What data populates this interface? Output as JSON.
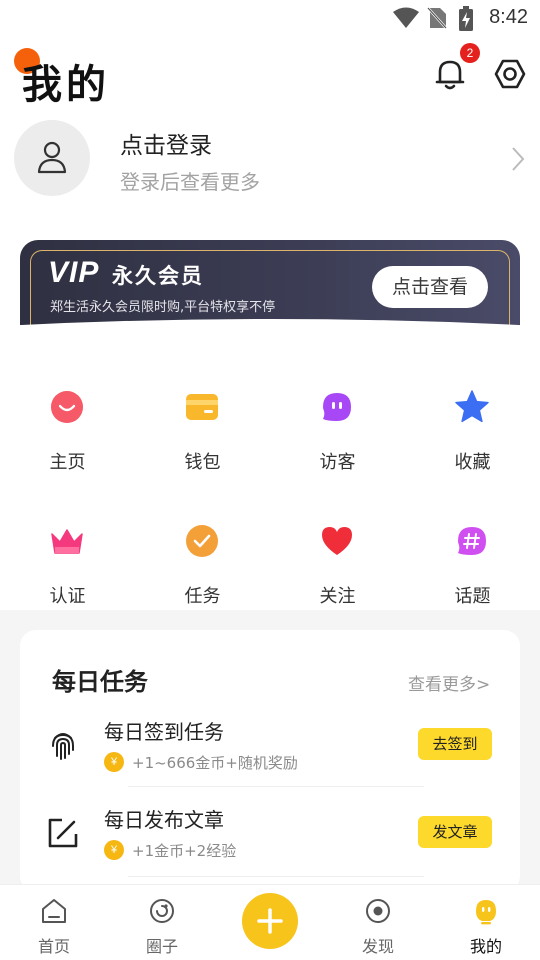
{
  "status_bar": {
    "time": "8:42"
  },
  "header": {
    "title": "我的",
    "notification_count": "2"
  },
  "profile": {
    "login_title": "点击登录",
    "login_subtitle": "登录后查看更多"
  },
  "vip": {
    "logo": "VIP",
    "title": "永久会员",
    "description": "郑生活永久会员限时购,平台特权享不停",
    "button": "点击查看"
  },
  "grid": [
    {
      "label": "主页",
      "icon": "smile-icon",
      "color": "#f1475c"
    },
    {
      "label": "钱包",
      "icon": "wallet-icon",
      "color": "#f9b82b"
    },
    {
      "label": "访客",
      "icon": "visitor-icon",
      "color": "#a847f5"
    },
    {
      "label": "收藏",
      "icon": "star-icon",
      "color": "#3c6ef3"
    },
    {
      "label": "认证",
      "icon": "crown-icon",
      "color": "#f5397e"
    },
    {
      "label": "任务",
      "icon": "check-icon",
      "color": "#f4a038"
    },
    {
      "label": "关注",
      "icon": "heart-icon",
      "color": "#ef2e3a"
    },
    {
      "label": "话题",
      "icon": "hashtag-icon",
      "color": "#d04ff0"
    }
  ],
  "tasks": {
    "heading": "每日任务",
    "more": "查看更多>",
    "items": [
      {
        "title": "每日签到任务",
        "reward": "+1~666金币+随机奖励",
        "button": "去签到",
        "icon": "fingerprint-icon"
      },
      {
        "title": "每日发布文章",
        "reward": "+1金币+2经验",
        "button": "发文章",
        "icon": "edit-icon"
      }
    ],
    "coin_symbol": "¥"
  },
  "nav": {
    "items": [
      {
        "label": "首页",
        "icon": "home-icon"
      },
      {
        "label": "圈子",
        "icon": "circle-icon"
      },
      {
        "label": "发现",
        "icon": "discover-icon"
      },
      {
        "label": "我的",
        "icon": "mine-icon"
      }
    ],
    "accent": "#f7c41c"
  }
}
